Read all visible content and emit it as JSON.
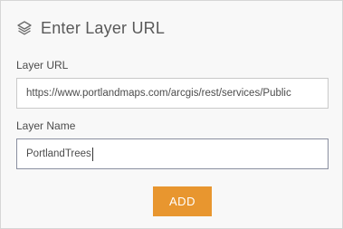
{
  "header": {
    "icon": "layers-icon",
    "title": "Enter Layer URL"
  },
  "layer_url": {
    "label": "Layer URL",
    "value": "https://www.portlandmaps.com/arcgis/rest/services/Public"
  },
  "layer_name": {
    "label": "Layer Name",
    "value": "PortlandTrees"
  },
  "actions": {
    "add_label": "ADD"
  },
  "colors": {
    "accent": "#e8962f",
    "panel_background": "#f8f8f8"
  }
}
